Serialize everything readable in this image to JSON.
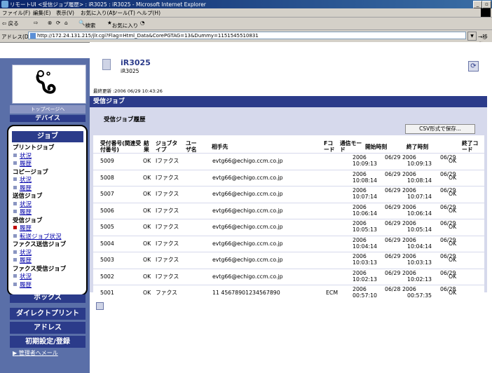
{
  "window": {
    "title": "リモートUI <受信ジョブ履歴> : iR3025 : iR3025 - Microsoft Internet Explorer",
    "controls": [
      "minimize-icon",
      "maximize-icon"
    ]
  },
  "menu": [
    "ファイル(F)",
    "編集(E)",
    "表示(V)",
    "お気に入り(A)",
    "ツール(T)",
    "ヘルプ(H)"
  ],
  "toolbar": {
    "back": "⇦ 戻る",
    "forward": "⇨",
    "search": "検索",
    "favorites": "お気に入り"
  },
  "address": {
    "label": "アドレス(D)",
    "url": "http://172.24.131.215/jlr.cgi?Flag=Html_Data&CorePGTAG=13&Dummy=1151545510831",
    "go": "移動"
  },
  "sidebar": {
    "top_page": "トップページへ",
    "device": "デバイス",
    "job_header": "ジョブ",
    "nav": [
      {
        "type": "cat",
        "label": "プリントジョブ"
      },
      {
        "type": "link",
        "label": "状況"
      },
      {
        "type": "link",
        "label": "履歴"
      },
      {
        "type": "cat",
        "label": "コピージョブ"
      },
      {
        "type": "link",
        "label": "状況"
      },
      {
        "type": "link",
        "label": "履歴"
      },
      {
        "type": "cat",
        "label": "送信ジョブ"
      },
      {
        "type": "link",
        "label": "状況"
      },
      {
        "type": "link",
        "label": "履歴"
      },
      {
        "type": "cat",
        "label": "受信ジョブ"
      },
      {
        "type": "link",
        "label": "履歴",
        "active": true
      },
      {
        "type": "link",
        "label": "転送ジョブ状況"
      },
      {
        "type": "cat",
        "label": "ファクス送信ジョブ"
      },
      {
        "type": "link",
        "label": "状況"
      },
      {
        "type": "link",
        "label": "履歴"
      },
      {
        "type": "cat",
        "label": "ファクス受信ジョブ"
      },
      {
        "type": "link",
        "label": "状況"
      },
      {
        "type": "link",
        "label": "履歴"
      }
    ],
    "box": "ボックス",
    "direct_print": "ダイレクトプリント",
    "address": "アドレス",
    "settings": "初期設定/登録",
    "admin_mail": "管理者へメール"
  },
  "device": {
    "name": "iR3025",
    "model": "iR3025"
  },
  "last_updated": "最終更新 :2006 06/29 10:43:26",
  "section_title": "受信ジョブ",
  "panel_title": "受信ジョブ履歴",
  "csv_button": "CSV形式で保存...",
  "table": {
    "headers": [
      "受付番号(関連受付番号)",
      "結果",
      "ジョブタイプ",
      "ユーザ名",
      "相手先",
      "Fコード",
      "通信モード",
      "開始時刻",
      "終了時刻",
      "終了コード"
    ],
    "rows": [
      {
        "id": "5009",
        "result": "OK",
        "type": "Iファクス",
        "user": "",
        "dest": "evtg66@echigo.ccm.co.jp",
        "fcode": "",
        "mode": "",
        "start_date": "2006",
        "start_time": "10:09:13",
        "end_date": "06/29 2006",
        "end_time": "10:09:13",
        "end_md": "06/29",
        "code": "OK"
      },
      {
        "id": "5008",
        "result": "OK",
        "type": "Iファクス",
        "user": "",
        "dest": "evtg66@echigo.ccm.co.jp",
        "fcode": "",
        "mode": "",
        "start_date": "2006",
        "start_time": "10:08:14",
        "end_date": "06/29 2006",
        "end_time": "10:08:14",
        "end_md": "06/29",
        "code": "OK"
      },
      {
        "id": "5007",
        "result": "OK",
        "type": "Iファクス",
        "user": "",
        "dest": "evtg66@echigo.ccm.co.jp",
        "fcode": "",
        "mode": "",
        "start_date": "2006",
        "start_time": "10:07:14",
        "end_date": "06/29 2006",
        "end_time": "10:07:14",
        "end_md": "06/29",
        "code": "OK"
      },
      {
        "id": "5006",
        "result": "OK",
        "type": "Iファクス",
        "user": "",
        "dest": "evtg66@echigo.ccm.co.jp",
        "fcode": "",
        "mode": "",
        "start_date": "2006",
        "start_time": "10:06:14",
        "end_date": "06/29 2006",
        "end_time": "10:06:14",
        "end_md": "06/29",
        "code": "OK"
      },
      {
        "id": "5005",
        "result": "OK",
        "type": "Iファクス",
        "user": "",
        "dest": "evtg66@echigo.ccm.co.jp",
        "fcode": "",
        "mode": "",
        "start_date": "2006",
        "start_time": "10:05:13",
        "end_date": "06/29 2006",
        "end_time": "10:05:14",
        "end_md": "06/29",
        "code": "OK"
      },
      {
        "id": "5004",
        "result": "OK",
        "type": "Iファクス",
        "user": "",
        "dest": "evtg66@echigo.ccm.co.jp",
        "fcode": "",
        "mode": "",
        "start_date": "2006",
        "start_time": "10:04:14",
        "end_date": "06/29 2006",
        "end_time": "10:04:14",
        "end_md": "06/29",
        "code": "OK"
      },
      {
        "id": "5003",
        "result": "OK",
        "type": "Iファクス",
        "user": "",
        "dest": "evtg66@echigo.ccm.co.jp",
        "fcode": "",
        "mode": "",
        "start_date": "2006",
        "start_time": "10:03:13",
        "end_date": "06/29 2006",
        "end_time": "10:03:13",
        "end_md": "06/29",
        "code": "OK"
      },
      {
        "id": "5002",
        "result": "OK",
        "type": "Iファクス",
        "user": "",
        "dest": "evtg66@echigo.ccm.co.jp",
        "fcode": "",
        "mode": "",
        "start_date": "2006",
        "start_time": "10:02:13",
        "end_date": "06/29 2006",
        "end_time": "10:02:13",
        "end_md": "06/29",
        "code": "OK"
      },
      {
        "id": "5001",
        "result": "OK",
        "type": "ファクス",
        "user": "",
        "dest": "11 45678901234567890",
        "fcode": "",
        "mode": "ECM",
        "start_date": "2006",
        "start_time": "00:57:10",
        "end_date": "06/28 2006",
        "end_time": "00:57:35",
        "end_md": "06/28",
        "code": "OK"
      }
    ]
  },
  "colors": {
    "sidebar_bg": "#5a6fa8",
    "nav_button": "#2b3b8a",
    "panel_bg": "#d6d9ec",
    "title_bar": "#0a246a"
  }
}
